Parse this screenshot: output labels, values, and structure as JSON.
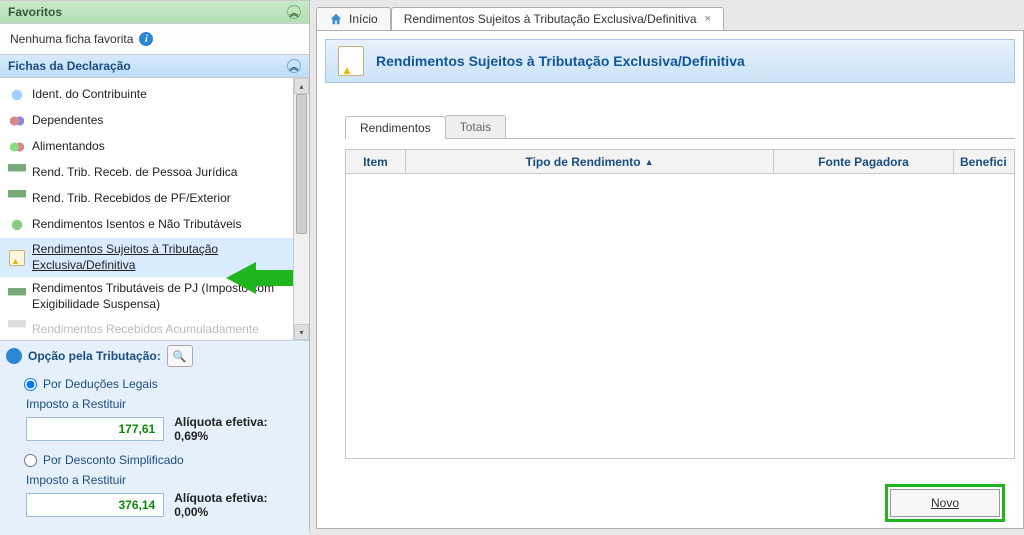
{
  "sidebar": {
    "favoritos_header": "Favoritos",
    "favoritos_empty": "Nenhuma ficha favorita",
    "fichas_header": "Fichas da Declaração",
    "items": [
      {
        "label": "Ident. do Contribuinte",
        "icon": "fi-ident"
      },
      {
        "label": "Dependentes",
        "icon": "fi-dep"
      },
      {
        "label": "Alimentandos",
        "icon": "fi-alim"
      },
      {
        "label": "Rend. Trib. Receb. de Pessoa Jurídica",
        "icon": "fi-pj"
      },
      {
        "label": "Rend. Trib. Recebidos de PF/Exterior",
        "icon": "fi-pf"
      },
      {
        "label": "Rendimentos Isentos e Não Tributáveis",
        "icon": "fi-isento"
      },
      {
        "label": "Rendimentos Sujeitos à Tributação Exclusiva/Definitiva",
        "icon": "fi-excl",
        "selected": true
      },
      {
        "label": "Rendimentos Tributáveis de PJ (Imposto com Exigibilidade Suspensa)",
        "icon": "fi-susp"
      },
      {
        "label": "Rendimentos Recebidos Acumuladamente",
        "icon": "fi-acum"
      }
    ],
    "taxation": {
      "header": "Opção pela Tributação:",
      "opt1_label": "Por Deduções Legais",
      "opt1_sub": "Imposto a Restituir",
      "opt1_value": "177,61",
      "opt1_aliq": "Alíquota efetiva: 0,69%",
      "opt2_label": "Por Desconto Simplificado",
      "opt2_sub": "Imposto a Restituir",
      "opt2_value": "376,14",
      "opt2_aliq": "Alíquota efetiva: 0,00%"
    }
  },
  "main": {
    "tab_home": "Início",
    "tab_active": "Rendimentos Sujeitos à Tributação Exclusiva/Definitiva",
    "title": "Rendimentos Sujeitos à Tributação Exclusiva/Definitiva",
    "subtabs": {
      "rend": "Rendimentos",
      "totais": "Totais"
    },
    "columns": {
      "item": "Item",
      "tipo": "Tipo de Rendimento",
      "fonte": "Fonte Pagadora",
      "benef": "Benefici"
    },
    "novo_label": "Novo"
  }
}
